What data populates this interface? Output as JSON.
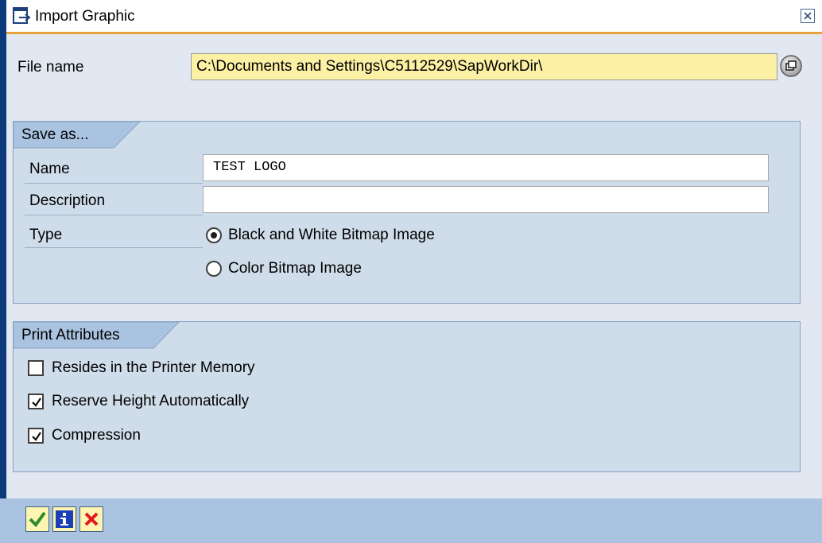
{
  "window": {
    "title": "Import Graphic",
    "icon": "import-graphic-icon",
    "close_icon": "close-icon"
  },
  "file": {
    "label": "File name",
    "value": "C:\\Documents and Settings\\C5112529\\SapWorkDir\\",
    "browse_icon": "browse-icon"
  },
  "save_as": {
    "title": "Save as...",
    "name_label": "Name",
    "name_value": "TEST LOGO",
    "description_label": "Description",
    "description_value": "",
    "type_label": "Type",
    "type_options": [
      {
        "label": "Black and White Bitmap Image",
        "selected": true
      },
      {
        "label": "Color Bitmap Image",
        "selected": false
      }
    ]
  },
  "print_attributes": {
    "title": "Print Attributes",
    "options": [
      {
        "label": "Resides in the Printer Memory",
        "checked": false
      },
      {
        "label": "Reserve Height Automatically",
        "checked": true
      },
      {
        "label": "Compression",
        "checked": true
      }
    ]
  },
  "footer": {
    "buttons": [
      {
        "icon": "check-icon",
        "color": "#2e8b2e"
      },
      {
        "icon": "info-icon",
        "color": "#1b3fb8"
      },
      {
        "icon": "cancel-icon",
        "color": "#e01a1a"
      }
    ]
  },
  "colors": {
    "accent_line": "#e6a33c",
    "group_background": "#cfdcea",
    "footer_background": "#a9c3e1",
    "file_field_background": "#fbf0a3"
  }
}
